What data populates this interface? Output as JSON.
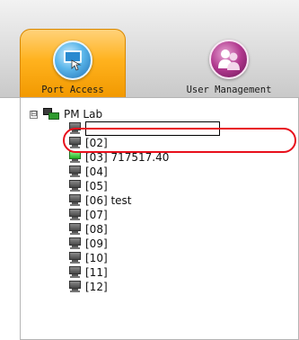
{
  "tabs": [
    {
      "label": "Port Access",
      "icon": "port-access-icon",
      "active": true
    },
    {
      "label": "User Management",
      "icon": "user-management-icon",
      "active": false
    }
  ],
  "tree": {
    "root": {
      "expander": "⊟",
      "label": "PM Lab",
      "icon": "network-icon"
    },
    "rename_input": {
      "value": ""
    },
    "ports": [
      {
        "label": "[02]",
        "online": false
      },
      {
        "label": "[03] 717517.40",
        "online": true
      },
      {
        "label": "[04]",
        "online": false
      },
      {
        "label": "[05]",
        "online": false
      },
      {
        "label": "[06] test",
        "online": false
      },
      {
        "label": "[07]",
        "online": false
      },
      {
        "label": "[08]",
        "online": false
      },
      {
        "label": "[09]",
        "online": false
      },
      {
        "label": "[10]",
        "online": false
      },
      {
        "label": "[11]",
        "online": false
      },
      {
        "label": "[12]",
        "online": false
      }
    ]
  },
  "colors": {
    "active_tab": "#ffb21e",
    "highlight": "#e8101c",
    "online_port": "#24b024"
  }
}
